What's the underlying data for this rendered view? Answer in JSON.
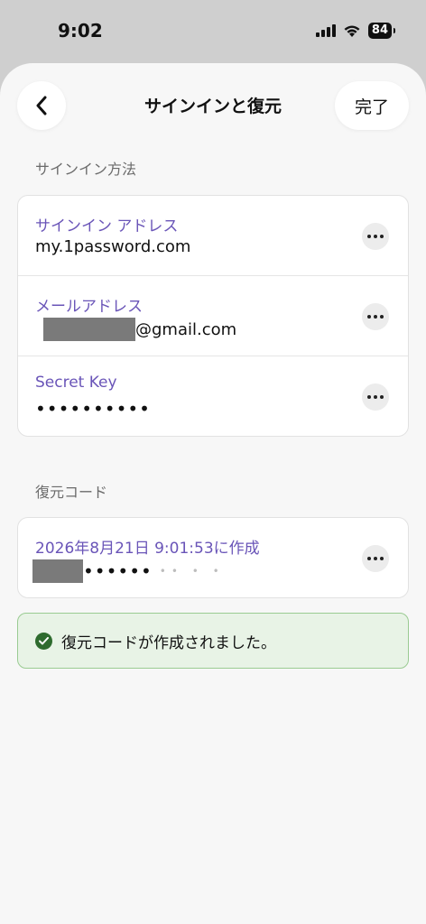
{
  "status_bar": {
    "time": "9:02",
    "battery": "84"
  },
  "header": {
    "title": "サインインと復元",
    "done_label": "完了",
    "back_icon": "chevron-left-icon"
  },
  "sign_in_section": {
    "label": "サインイン方法",
    "rows": [
      {
        "label": "サインイン アドレス",
        "value": "my.1password.com"
      },
      {
        "label": "メールアドレス",
        "value": "@gmail.com"
      },
      {
        "label": "Secret Key",
        "value": "••••••••••"
      }
    ]
  },
  "recovery_section": {
    "label": "復元コード",
    "code_label": "2026年8月21日 9:01:53に作成",
    "code_value": "••••••"
  },
  "toast": {
    "message": "復元コードが作成されました。"
  },
  "colors": {
    "accent": "#6a55b8",
    "success_bg": "#e8f3e6",
    "success_border": "#9acb92",
    "success_icon": "#2e6b2e"
  }
}
